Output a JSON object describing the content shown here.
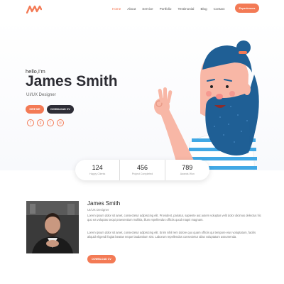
{
  "nav": {
    "logo_icon": "zigzag-logo",
    "links": [
      "Home",
      "About",
      "Service",
      "Portfolio",
      "Testimonial",
      "Blog",
      "Contact"
    ],
    "active_link": "Home",
    "cta_label": "Experiences"
  },
  "hero": {
    "greeting": "hello,I'm",
    "name": "James Smith",
    "role": "UI/UX Designer",
    "hire_label": "HIRE ME",
    "cv_label": "DOWNLOAD CV",
    "socials": [
      {
        "icon": "facebook-icon",
        "glyph": "f"
      },
      {
        "icon": "google-plus-icon",
        "glyph": "g"
      },
      {
        "icon": "twitter-icon",
        "glyph": "t"
      },
      {
        "icon": "instagram-icon",
        "glyph": "◎"
      }
    ]
  },
  "stats": [
    {
      "value": "124",
      "label": "Happy Clients"
    },
    {
      "value": "456",
      "label": "Project Completed"
    },
    {
      "value": "789",
      "label": "Awards Won"
    }
  ],
  "about": {
    "name": "James Smith",
    "role": "UI/UX Designer",
    "paragraph1": "Lorem ipsum dolor sit amet, consectetur adipisicing elit. Provident, pariatur, sapiente aut autem voluptas velit dolor dicimus delectus hic quo ea voluptas sequi praesentium mollitia, illum repellendus officiis quod magni magnam.",
    "paragraph2": "Lorem ipsum dolor sit amet, consectetur adipisicing elit. Enim nihil rem dolore quo quam officiis qui tempore eius voluptatum, facilis aliquid eligendi fugiat beatae neque laudantium sint. Laborum repellendus consectetur alias voluptatum assumenda.",
    "download_label": "DOWNLOAD CV"
  },
  "colors": {
    "accent": "#f37a55",
    "dark": "#2d2d36",
    "beard": "#1f5f95",
    "skin": "#f8b7a6"
  }
}
